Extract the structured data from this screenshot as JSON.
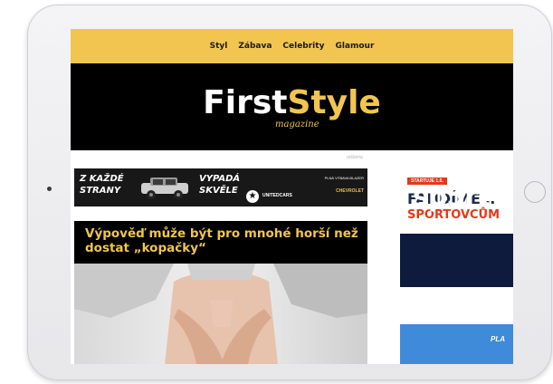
{
  "nav": {
    "items": [
      {
        "label": "Styl"
      },
      {
        "label": "Zábava"
      },
      {
        "label": "Celebrity"
      },
      {
        "label": "Glamour"
      }
    ]
  },
  "brand": {
    "logo_first": "First",
    "logo_style": "Style",
    "tagline": "magazine"
  },
  "ad_label": "reklama",
  "banner_ad": {
    "left_text": "Z KAŽDÉ STRANY",
    "mid_text": "VYPADÁ SKVĚLE",
    "dealer": "UNITEDCARS",
    "brand_right": "PLNÁ VÝBAVA BLAZER",
    "chevrolet": "CHEVROLET"
  },
  "article": {
    "headline": "Výpověď může být pro mnohé horší než dostat „kopačky“"
  },
  "side_ad": {
    "badge": "STARTUJE 1.6.",
    "line1": "FANDÍME…",
    "line2": "SPORTOVCŮM",
    "logo": "sp5rt"
  },
  "side_ad2": {
    "label": "PLA"
  },
  "colors": {
    "accent": "#f1c550",
    "masthead": "#000000",
    "sport_red": "#e4391b",
    "sport_navy": "#0f1b3d"
  }
}
